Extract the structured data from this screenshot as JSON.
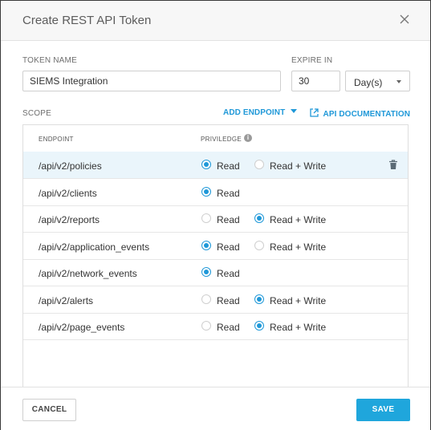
{
  "dialog": {
    "title": "Create REST API Token",
    "close_icon": "close-icon"
  },
  "form": {
    "token_name_label": "TOKEN NAME",
    "token_name_value": "SIEMS Integration",
    "expire_label": "EXPIRE IN",
    "expire_value": "30",
    "expire_unit": "Day(s)"
  },
  "scope": {
    "label": "SCOPE",
    "add_endpoint_label": "ADD ENDPOINT",
    "api_docs_label": "API DOCUMENTATION",
    "columns": {
      "endpoint": "ENDPOINT",
      "privilege": "PRIVILEDGE"
    },
    "read_label": "Read",
    "read_write_label": "Read + Write",
    "rows": [
      {
        "endpoint": "/api/v2/policies",
        "selected": "read",
        "has_write": true,
        "highlighted": true
      },
      {
        "endpoint": "/api/v2/clients",
        "selected": "read",
        "has_write": false
      },
      {
        "endpoint": "/api/v2/reports",
        "selected": "write",
        "has_write": true
      },
      {
        "endpoint": "/api/v2/application_events",
        "selected": "read",
        "has_write": true
      },
      {
        "endpoint": "/api/v2/network_events",
        "selected": "read",
        "has_write": false
      },
      {
        "endpoint": "/api/v2/alerts",
        "selected": "write",
        "has_write": true
      },
      {
        "endpoint": "/api/v2/page_events",
        "selected": "write",
        "has_write": true
      }
    ]
  },
  "footer": {
    "cancel_label": "CANCEL",
    "save_label": "SAVE"
  },
  "colors": {
    "accent": "#1f98d8",
    "save_button": "#1fa6dc",
    "selected_row": "#eaf5fb"
  }
}
